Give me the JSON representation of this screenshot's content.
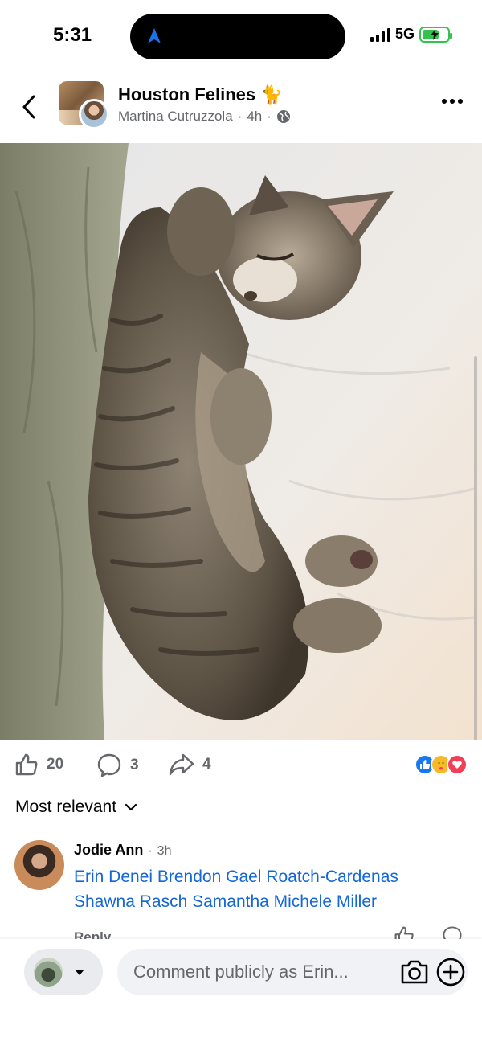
{
  "status_bar": {
    "time": "5:31",
    "network": "5G"
  },
  "header": {
    "group_name": "Houston Felines 🐈",
    "author": "Martina Cutruzzola",
    "time_ago": "4h",
    "separator": "·"
  },
  "photo": {
    "icon": "photo-of-sleeping-tabby-kitten"
  },
  "actions": {
    "likes": "20",
    "comments": "3",
    "shares": "4"
  },
  "reactions": [
    "like",
    "care",
    "love"
  ],
  "sort": {
    "label": "Most relevant"
  },
  "comment": {
    "author": "Jodie Ann",
    "separator": "·",
    "time_ago": "3h",
    "text": "Erin Denei Brendon Gael Roatch-Cardenas Shawna Rasch Samantha Michele Miller",
    "reply_label": "Reply"
  },
  "composer": {
    "placeholder": "Comment publicly as Erin..."
  },
  "colors": {
    "link": "#1467d6",
    "secondary_text": "#65676b",
    "like_blue": "#1877f2",
    "love_red": "#f33e58",
    "care_yellow": "#f7b928",
    "battery_green": "#32c24d"
  }
}
